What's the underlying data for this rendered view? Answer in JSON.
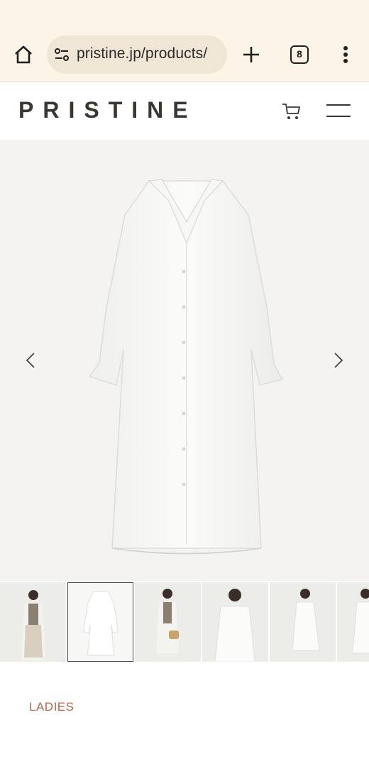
{
  "browser": {
    "url": "pristine.jp/products/",
    "tab_count": "8"
  },
  "header": {
    "logo": "PRISTINE"
  },
  "product": {
    "thumbnails": [
      "model-beige-outfit",
      "dress-flat",
      "model-bag",
      "model-white-dress",
      "model-white-dress-2",
      "model-white-dress-3"
    ],
    "selected_thumbnail": 2,
    "category": "LADIES"
  }
}
